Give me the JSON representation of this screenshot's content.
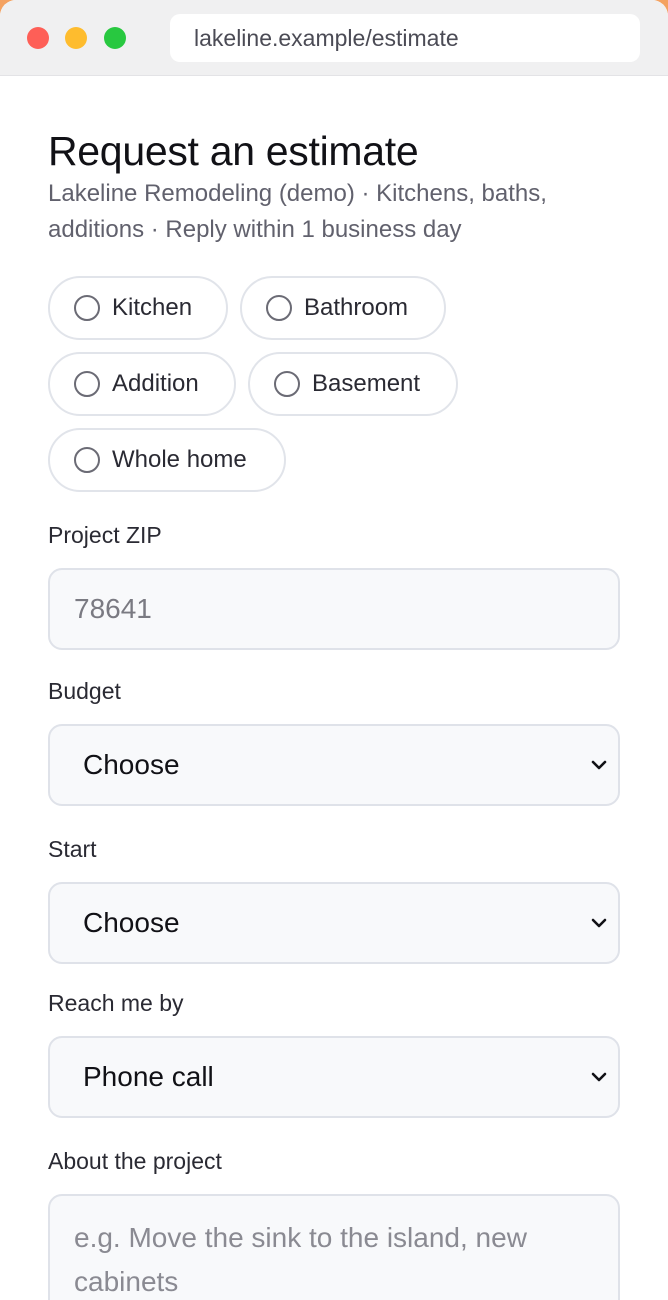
{
  "browser": {
    "url": "lakeline.example/estimate"
  },
  "page": {
    "title": "Request an estimate",
    "subtitle": "Lakeline Remodeling (demo) · Kitchens, baths, additions · Reply within 1 business day"
  },
  "project_types": [
    {
      "label": "Kitchen",
      "checked": false
    },
    {
      "label": "Bathroom",
      "checked": false
    },
    {
      "label": "Addition",
      "checked": false
    },
    {
      "label": "Basement",
      "checked": false
    },
    {
      "label": "Whole home",
      "checked": false
    }
  ],
  "zip": {
    "label": "Project ZIP",
    "placeholder": "78641"
  },
  "budget": {
    "label": "Budget",
    "value": "Choose"
  },
  "start": {
    "label": "Start",
    "value": "Choose"
  },
  "contact": {
    "label": "Reach me by",
    "value": "Phone call"
  },
  "about": {
    "label": "About the project",
    "placeholder": "e.g. Move the sink to the island, new cabinets"
  },
  "colors": {
    "accent_background": "#f4a261",
    "field_border": "#dfe2e9",
    "field_background": "#f8f9fb"
  }
}
